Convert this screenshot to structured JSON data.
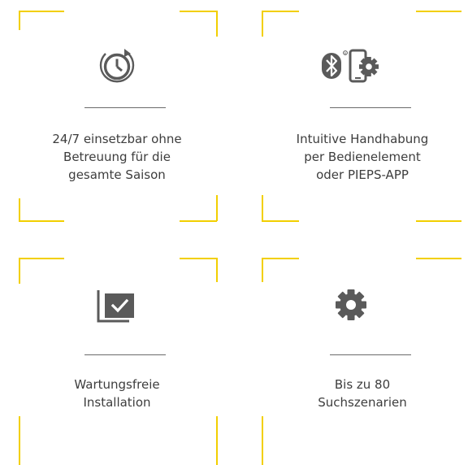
{
  "accent_color": "#f2cf00",
  "icon_color": "#5a5a5a",
  "features": [
    {
      "icon": "clock-refresh-icon",
      "lines": [
        "24/7 einsetzbar ohne",
        "Betreuung für die",
        "gesamte Saison"
      ]
    },
    {
      "icon": "bluetooth-phone-gear-icon",
      "lines": [
        "Intuitive Handhabung",
        "per Bedienelement",
        "oder PIEPS-APP"
      ]
    },
    {
      "icon": "checkbox-icon",
      "lines": [
        "Wartungsfreie",
        "Installation"
      ]
    },
    {
      "icon": "gear-icon",
      "lines": [
        "Bis zu 80",
        "Suchszenarien"
      ]
    }
  ]
}
